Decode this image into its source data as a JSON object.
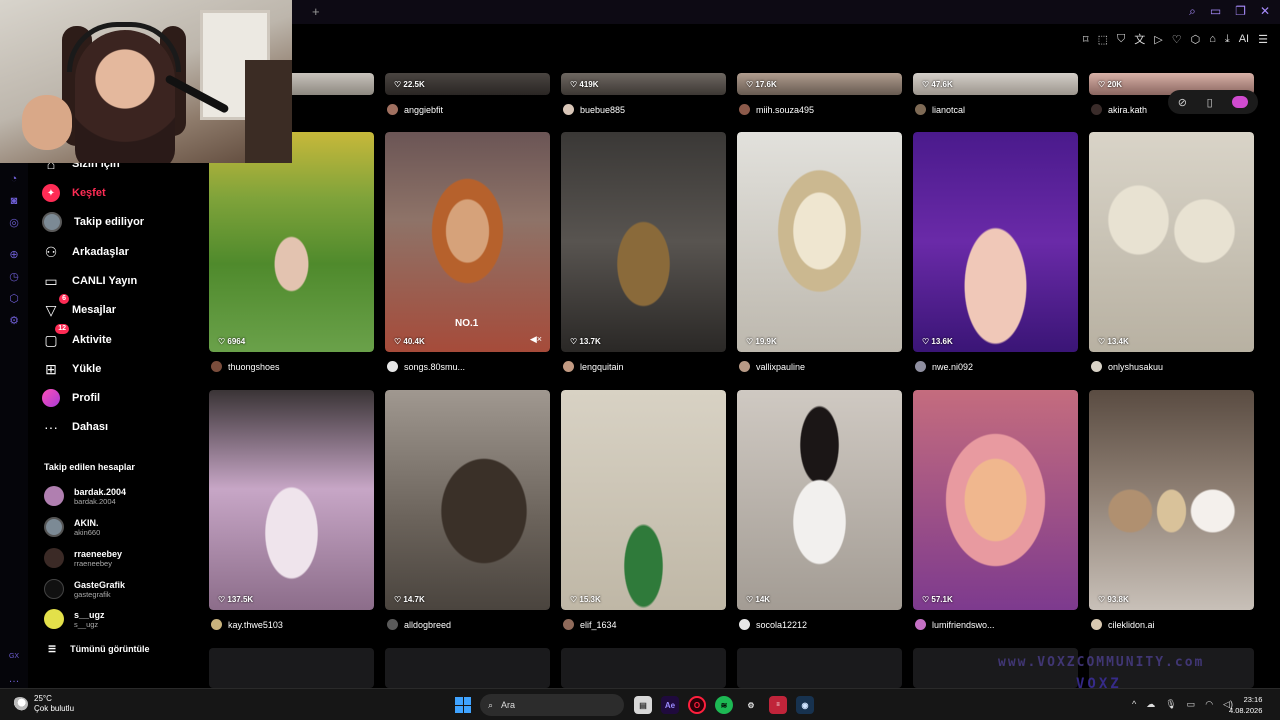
{
  "browser": {
    "new_tab": "+"
  },
  "nav": [
    {
      "label": "Sizin için",
      "icon": "home-icon"
    },
    {
      "label": "Keşfet",
      "icon": "compass-icon"
    },
    {
      "label": "Takip ediliyor",
      "icon": "following-icon"
    },
    {
      "label": "Arkadaşlar",
      "icon": "friends-icon"
    },
    {
      "label": "CANLI Yayın",
      "icon": "live-icon"
    },
    {
      "label": "Mesajlar",
      "icon": "messages-icon",
      "badge": "6"
    },
    {
      "label": "Aktivite",
      "icon": "activity-icon",
      "badge": "12"
    },
    {
      "label": "Yükle",
      "icon": "upload-icon"
    },
    {
      "label": "Profil",
      "icon": "profile-icon"
    },
    {
      "label": "Dahası",
      "icon": "more-icon"
    }
  ],
  "following": {
    "title": "Takip edilen hesaplar",
    "accounts": [
      {
        "name": "bardak.2004",
        "handle": "bardak.2004"
      },
      {
        "name": "AKIN.",
        "handle": "akin660"
      },
      {
        "name": "rraeneebey",
        "handle": "rraeneebey"
      },
      {
        "name": "GasteGrafik",
        "handle": "gastegrafik"
      },
      {
        "name": "s__ugz",
        "handle": "s__ugz"
      }
    ],
    "show_all": "Tümünü görüntüle"
  },
  "row0": [
    {
      "likes": "",
      "user": ""
    },
    {
      "likes": "22.5K",
      "user": "anggiebfit"
    },
    {
      "likes": "419K",
      "user": "buebue885"
    },
    {
      "likes": "17.6K",
      "user": "miih.souza495"
    },
    {
      "likes": "47.6K",
      "user": "lianotcal"
    },
    {
      "likes": "20K",
      "user": "akira.kath"
    }
  ],
  "row1": [
    {
      "likes": "6964",
      "user": "thuongshoes"
    },
    {
      "likes": "40.4K",
      "user": "songs.80smu...",
      "caption": "NO.1"
    },
    {
      "likes": "13.7K",
      "user": "lengquitain"
    },
    {
      "likes": "19.9K",
      "user": "vallixpauline"
    },
    {
      "likes": "13.6K",
      "user": "nwe.ni092"
    },
    {
      "likes": "13.4K",
      "user": "onlyshusakuu"
    }
  ],
  "row2": [
    {
      "likes": "137.5K",
      "user": "kay.thwe5103"
    },
    {
      "likes": "14.7K",
      "user": "alldogbreed"
    },
    {
      "likes": "15.3K",
      "user": "elif_1634"
    },
    {
      "likes": "14K",
      "user": "socola12212"
    },
    {
      "likes": "57.1K",
      "user": "lumifriendswo..."
    },
    {
      "likes": "93.8K",
      "user": "cileklidon.ai"
    }
  ],
  "watermark": {
    "line1": "www.VOXZCOMMUNITY.com",
    "line2": "VOXZ"
  },
  "taskbar": {
    "temp": "25°C",
    "weather": "Çok bulutlu",
    "search": "Ara",
    "time": "23:16",
    "date": "4.08.2026",
    "apps": [
      "files-icon",
      "ae-icon",
      "opera-icon",
      "spotify-icon",
      "steam-tools-icon",
      "news-icon",
      "steam-icon"
    ]
  },
  "colors": {
    "accent": "#fe2c55",
    "opera": "#6d5dd3",
    "bg": "#000000"
  }
}
